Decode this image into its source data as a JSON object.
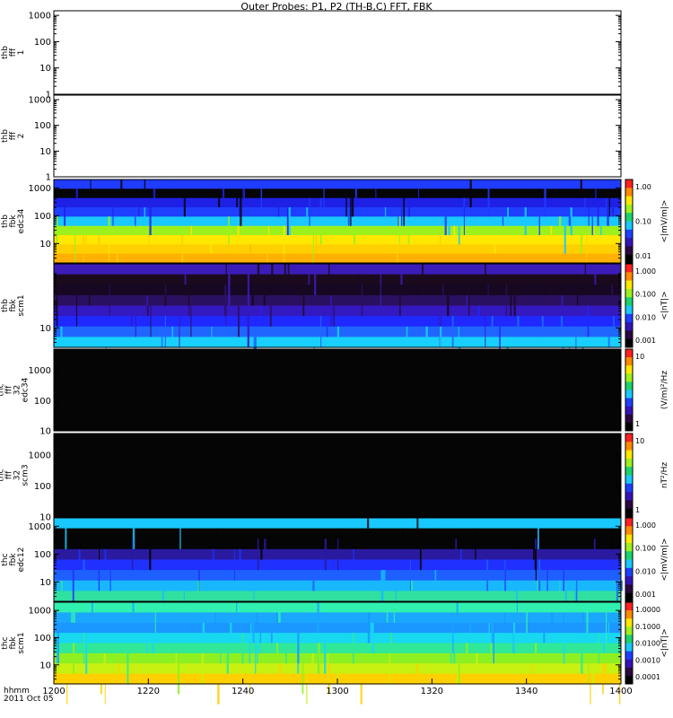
{
  "title": "Outer Probes: P1, P2 (TH-B,C) FFT, FBK",
  "chart_data": {
    "type": "heatmap",
    "title": "Outer Probes: P1, P2 (TH-B,C) FFT, FBK",
    "time_axis": {
      "label_line1": "hhmm",
      "label_line2": "2011 Oct 05",
      "ticks": [
        "1200",
        "1220",
        "1240",
        "1300",
        "1320",
        "1340",
        "1400"
      ],
      "range": [
        "1200",
        "1400"
      ]
    },
    "panels": [
      {
        "id": "thb-fff1",
        "ylabel": [
          "thb",
          "fff",
          "1"
        ],
        "yticks": [
          "1000",
          "100",
          "10",
          "1"
        ],
        "yscale": "log",
        "yrange": [
          1,
          1500
        ],
        "colorbar": null,
        "spectrogram": null
      },
      {
        "id": "thb-fff2",
        "ylabel": [
          "thb",
          "fff",
          "2"
        ],
        "yticks": [
          "1000",
          "100",
          "10",
          "1"
        ],
        "yscale": "log",
        "yrange": [
          1,
          1500
        ],
        "colorbar": null,
        "spectrogram": null
      },
      {
        "id": "thb-fbk-edc34",
        "ylabel": [
          "thb",
          "fbk",
          "edc34"
        ],
        "yticks": [
          "1000",
          "100",
          "10"
        ],
        "yscale": "log",
        "yrange": [
          2,
          2000
        ],
        "colorbar": {
          "label": "<|mV/m|>",
          "ticks": [
            "1.00",
            "0.10",
            "0.01"
          ]
        },
        "spectrogram": {
          "bands": [
            "#1f3cff",
            "#050505",
            "#1f20e6",
            "#1e3fff",
            "#19c8ff",
            "#9cf01c",
            "#ffe800",
            "#ffd000",
            "#ffb000"
          ],
          "stripes": "dense"
        }
      },
      {
        "id": "thb-fbk-scm1",
        "ylabel": [
          "thb",
          "fbk",
          "scm1"
        ],
        "yticks": [
          "10"
        ],
        "yscale": "log",
        "yrange": [
          2,
          2000
        ],
        "colorbar": {
          "label": "<|nT|>",
          "ticks": [
            "1.000",
            "0.100",
            "0.010",
            "0.001"
          ]
        },
        "spectrogram": {
          "bands": [
            "#3c1cb8",
            "#1b0a1e",
            "#160822",
            "#2a1060",
            "#3418c0",
            "#1e28ff",
            "#1f66ff",
            "#18d0ff"
          ],
          "stripes": "dense"
        }
      },
      {
        "id": "thc-fff32-edc34",
        "ylabel": [
          "thc",
          "fff",
          "32",
          "edc34"
        ],
        "yticks": [
          "1000",
          "100",
          "10"
        ],
        "yscale": "log",
        "yrange": [
          10,
          5000
        ],
        "colorbar": {
          "label": "(V/m)²/Hz",
          "ticks": [
            "10",
            "1"
          ]
        },
        "spectrogram": {
          "bands": [
            "#050505"
          ],
          "stripes": "none"
        }
      },
      {
        "id": "thc-fff32-scm3",
        "ylabel": [
          "thc",
          "fff",
          "32",
          "scm3"
        ],
        "yticks": [
          "1000",
          "100",
          "10"
        ],
        "yscale": "log",
        "yrange": [
          10,
          5000
        ],
        "colorbar": {
          "label": "nT²/Hz",
          "ticks": [
            "10",
            "1"
          ]
        },
        "spectrogram": {
          "bands": [
            "#050505"
          ],
          "stripes": "none"
        }
      },
      {
        "id": "thc-fbk-edc12",
        "ylabel": [
          "thc",
          "fbk",
          "edc12"
        ],
        "yticks": [
          "1000",
          "100",
          "10"
        ],
        "yscale": "log",
        "yrange": [
          2,
          2000
        ],
        "colorbar": {
          "label": "<|mV/m|>",
          "ticks": [
            "1.000",
            "0.100",
            "0.010",
            "0.001"
          ]
        },
        "spectrogram": {
          "bands": [
            "#19c8ff",
            "#050505",
            "#050505",
            "#2a1aa0",
            "#1f30ff",
            "#1e60ff",
            "#18b8ff",
            "#30e0a0"
          ],
          "stripes": "sparse"
        }
      },
      {
        "id": "thc-fbk-scm1",
        "ylabel": [
          "thc",
          "fbk",
          "scm1"
        ],
        "yticks": [
          "1000",
          "100",
          "10"
        ],
        "yscale": "log",
        "yrange": [
          2,
          2000
        ],
        "colorbar": {
          "label": "<|nT|>",
          "ticks": [
            "1.0000",
            "0.1000",
            "0.0100",
            "0.0010",
            "0.0001"
          ]
        },
        "spectrogram": {
          "bands": [
            "#30f0b0",
            "#1aa8ff",
            "#1a98ff",
            "#18d8f0",
            "#30e898",
            "#8ef020",
            "#c8f010",
            "#ffd000"
          ],
          "stripes": "dense"
        }
      }
    ]
  }
}
